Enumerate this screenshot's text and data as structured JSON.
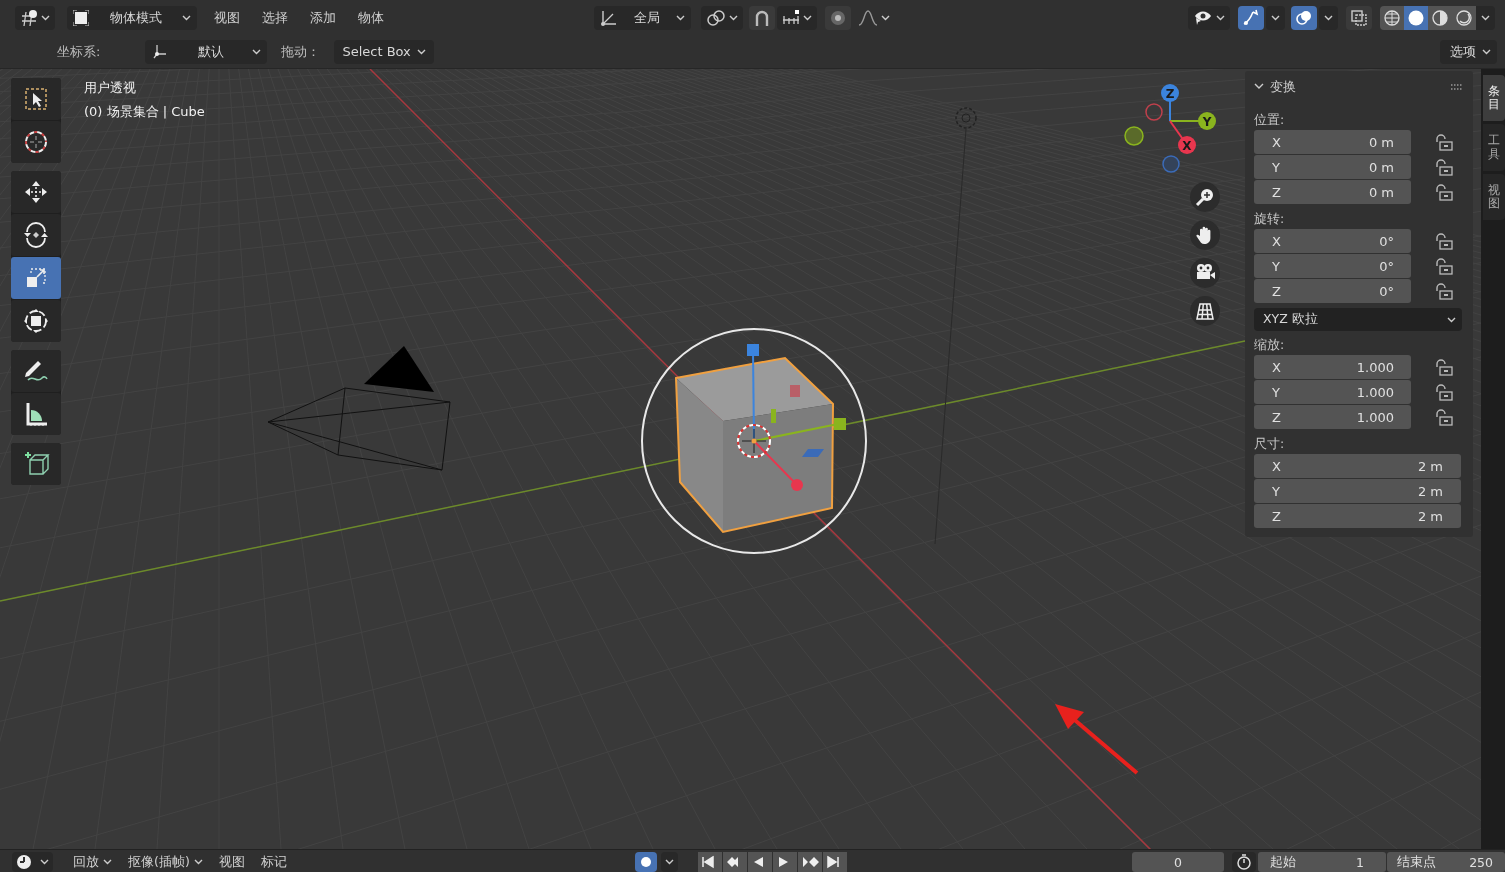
{
  "header": {
    "mode": "物体模式",
    "menus": [
      "视图",
      "选择",
      "添加",
      "物体"
    ],
    "orientation": "全局",
    "toggles": [
      {
        "kind": "snap",
        "on": false
      },
      {
        "kind": "proportional",
        "on": false
      },
      {
        "kind": "gizmo",
        "on": true
      },
      {
        "kind": "overlay",
        "on": true
      },
      {
        "kind": "xray",
        "on": false
      }
    ],
    "shading": [
      {
        "kind": "wireframe",
        "selected": false
      },
      {
        "kind": "solid",
        "selected": true
      },
      {
        "kind": "material",
        "selected": false
      },
      {
        "kind": "rendered",
        "selected": false
      }
    ]
  },
  "tool_settings": {
    "orientation_label": "坐标系:",
    "orientation": "默认",
    "drag_label": "拖动：",
    "drag": "Select Box",
    "options": "选项"
  },
  "toolbar_groups": [
    {
      "tools": [
        {
          "kind": "select_box",
          "selected": false
        },
        {
          "kind": "cursor",
          "selected": false
        }
      ]
    },
    {
      "tools": [
        {
          "kind": "move",
          "selected": false
        },
        {
          "kind": "rotate",
          "selected": false
        },
        {
          "kind": "scale",
          "selected": true
        },
        {
          "kind": "transform",
          "selected": false
        }
      ]
    },
    {
      "tools": [
        {
          "kind": "annotate",
          "selected": false
        },
        {
          "kind": "measure",
          "selected": false
        }
      ]
    },
    {
      "tools": [
        {
          "kind": "add_cube",
          "selected": false
        }
      ]
    }
  ],
  "viewport": {
    "view_name": "用户透视",
    "collection": "(0) 场景集合 | Cube"
  },
  "gizmo": {
    "axis_labels": [
      "Z",
      "Y",
      "X"
    ]
  },
  "sidebar": {
    "panel": "变换",
    "expanded": true,
    "groups": [
      {
        "label": "位置:",
        "fields": [
          {
            "axis": "X",
            "value": "0 m",
            "locked": false
          },
          {
            "axis": "Y",
            "value": "0 m",
            "locked": false
          },
          {
            "axis": "Z",
            "value": "0 m",
            "locked": false
          }
        ]
      },
      {
        "label": "旋转:",
        "fields": [
          {
            "axis": "X",
            "value": "0°",
            "locked": false
          },
          {
            "axis": "Y",
            "value": "0°",
            "locked": false
          },
          {
            "axis": "Z",
            "value": "0°",
            "locked": false
          }
        ],
        "mode": "XYZ 欧拉"
      },
      {
        "label": "缩放:",
        "fields": [
          {
            "axis": "X",
            "value": "1.000",
            "locked": false
          },
          {
            "axis": "Y",
            "value": "1.000",
            "locked": false
          },
          {
            "axis": "Z",
            "value": "1.000",
            "locked": false
          }
        ]
      },
      {
        "label": "尺寸:",
        "fields": [
          {
            "axis": "X",
            "value": "2 m"
          },
          {
            "axis": "Y",
            "value": "2 m"
          },
          {
            "axis": "Z",
            "value": "2 m"
          }
        ]
      }
    ],
    "tabs": [
      {
        "label": "条目",
        "selected": true
      },
      {
        "label": "工具",
        "selected": false
      },
      {
        "label": "视图",
        "selected": false
      }
    ]
  },
  "timeline": {
    "menus": [
      "回放",
      "抠像(插帧)",
      "视图",
      "标记"
    ],
    "current_frame": "0",
    "start_label": "起始",
    "start": "1",
    "end_label": "结束点",
    "end": "250"
  }
}
